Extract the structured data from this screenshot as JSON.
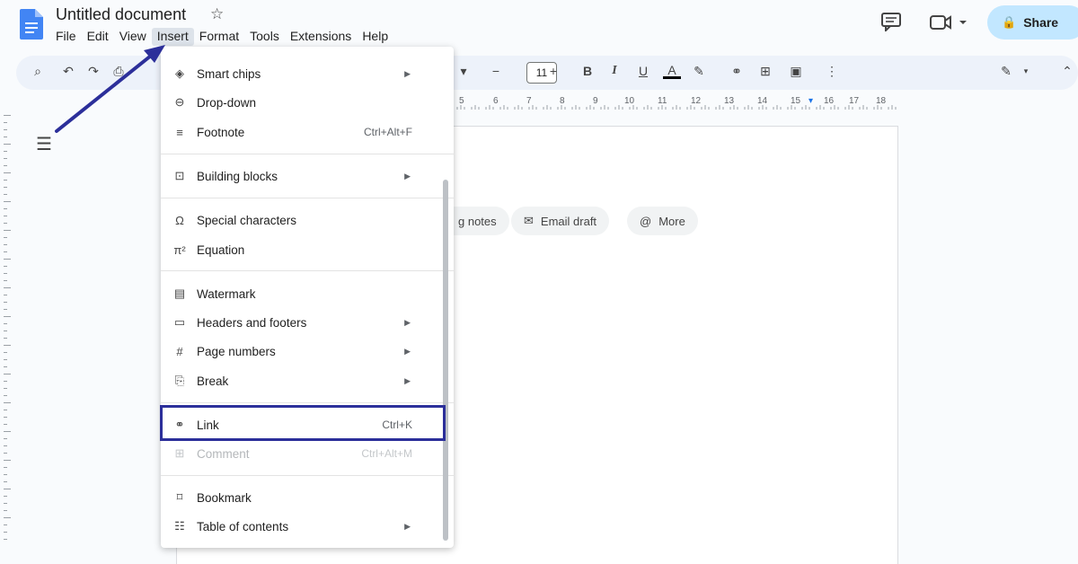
{
  "header": {
    "title": "Untitled document",
    "share_label": "Share"
  },
  "menubar": [
    "File",
    "Edit",
    "View",
    "Insert",
    "Format",
    "Tools",
    "Extensions",
    "Help"
  ],
  "toolbar": {
    "font_size": "11"
  },
  "ruler_numbers": [
    "5",
    "6",
    "7",
    "8",
    "9",
    "10",
    "11",
    "12",
    "13",
    "14",
    "15",
    "16",
    "17",
    "18"
  ],
  "chips": [
    {
      "label": "g notes",
      "icon": "notes-icon"
    },
    {
      "label": "Email draft",
      "icon": "email-draft-icon"
    },
    {
      "label": "More",
      "icon": "at-icon"
    }
  ],
  "insert_menu": {
    "smart_chips": "Smart chips",
    "dropdown": "Drop-down",
    "footnote": "Footnote",
    "footnote_shortcut": "Ctrl+Alt+F",
    "building_blocks": "Building blocks",
    "special_characters": "Special characters",
    "equation": "Equation",
    "watermark": "Watermark",
    "headers_footers": "Headers and footers",
    "page_numbers": "Page numbers",
    "break": "Break",
    "link": "Link",
    "link_shortcut": "Ctrl+K",
    "comment": "Comment",
    "comment_shortcut": "Ctrl+Alt+M",
    "bookmark": "Bookmark",
    "table_of_contents": "Table of contents"
  },
  "colors": {
    "accent": "#2c2f9a",
    "share_bg": "#c2e7ff",
    "docs_blue": "#4285f4"
  }
}
